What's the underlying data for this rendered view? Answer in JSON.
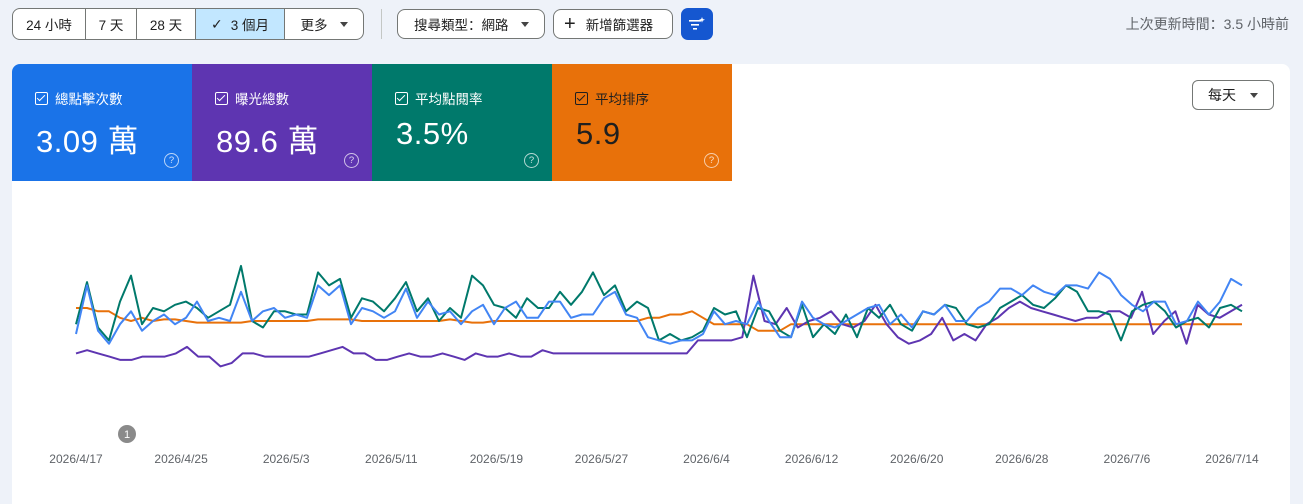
{
  "toolbar": {
    "ranges": [
      {
        "label": "24 小時",
        "active": false
      },
      {
        "label": "7 天",
        "active": false
      },
      {
        "label": "28 天",
        "active": false
      },
      {
        "label": "3 個月",
        "active": true
      },
      {
        "label": "更多",
        "active": false
      }
    ],
    "search_type": "搜尋類型：網路",
    "add_filter": "新增篩選器",
    "last_updated": "上次更新時間：3.5 小時前"
  },
  "metrics": [
    {
      "label": "總點擊次數",
      "value": "3.09 萬",
      "color": "#1a73e8"
    },
    {
      "label": "曝光總數",
      "value": "89.6 萬",
      "color": "#5e35b1"
    },
    {
      "label": "平均點閱率",
      "value": "3.5%",
      "color": "#00796b"
    },
    {
      "label": "平均排序",
      "value": "5.9",
      "color": "#e8710a"
    }
  ],
  "granularity": "每天",
  "annotation": "1",
  "chart_data": {
    "type": "line",
    "x_labels": [
      "2026/4/17",
      "2026/4/25",
      "2026/5/3",
      "2026/5/11",
      "2026/5/19",
      "2026/5/27",
      "2026/6/4",
      "2026/6/12",
      "2026/6/20",
      "2026/6/28",
      "2026/7/6",
      "2026/7/14"
    ],
    "annotation_date": "2026/4/20",
    "series": [
      {
        "name": "總點擊次數",
        "color": "#4285f4",
        "values": [
          42,
          72,
          44,
          36,
          48,
          56,
          44,
          50,
          54,
          48,
          52,
          62,
          50,
          52,
          50,
          68,
          50,
          56,
          58,
          52,
          54,
          52,
          72,
          66,
          72,
          48,
          58,
          56,
          52,
          56,
          70,
          52,
          62,
          54,
          56,
          48,
          56,
          60,
          48,
          58,
          62,
          52,
          52,
          62,
          62,
          52,
          54,
          54,
          64,
          68,
          54,
          52,
          40,
          38,
          36,
          38,
          38,
          42,
          56,
          48,
          50,
          48,
          62,
          50,
          40,
          40,
          62,
          52,
          48,
          46,
          50,
          54,
          58,
          60,
          48,
          54,
          46,
          56,
          54,
          60,
          50,
          50,
          58,
          62,
          70,
          70,
          66,
          72,
          68,
          66,
          72,
          72,
          70,
          80,
          76,
          66,
          60,
          56,
          62,
          62,
          48,
          50,
          62,
          54,
          62,
          76,
          72
        ]
      },
      {
        "name": "曝光總數",
        "color": "#5e35b1",
        "values": [
          30,
          32,
          30,
          28,
          26,
          26,
          28,
          28,
          28,
          30,
          34,
          28,
          28,
          22,
          24,
          30,
          30,
          28,
          28,
          28,
          28,
          28,
          30,
          32,
          34,
          30,
          30,
          26,
          26,
          28,
          30,
          28,
          28,
          30,
          28,
          26,
          30,
          28,
          28,
          30,
          28,
          28,
          32,
          30,
          30,
          30,
          30,
          30,
          30,
          30,
          30,
          30,
          30,
          30,
          30,
          30,
          38,
          38,
          38,
          38,
          40,
          78,
          50,
          48,
          58,
          46,
          50,
          52,
          56,
          48,
          46,
          50,
          60,
          48,
          40,
          36,
          38,
          42,
          52,
          38,
          42,
          38,
          48,
          52,
          58,
          62,
          58,
          56,
          54,
          52,
          50,
          52,
          52,
          56,
          56,
          52,
          68,
          42,
          50,
          56,
          36,
          60,
          54,
          52,
          56,
          60
        ]
      },
      {
        "name": "平均點閱率",
        "color": "#00796b",
        "values": [
          48,
          74,
          46,
          38,
          62,
          78,
          48,
          58,
          56,
          60,
          62,
          58,
          52,
          56,
          60,
          84,
          50,
          46,
          56,
          56,
          54,
          54,
          80,
          72,
          76,
          52,
          64,
          62,
          56,
          64,
          74,
          56,
          64,
          50,
          58,
          52,
          78,
          72,
          60,
          58,
          52,
          64,
          58,
          58,
          68,
          60,
          68,
          80,
          66,
          72,
          56,
          62,
          58,
          38,
          42,
          38,
          40,
          44,
          58,
          54,
          56,
          40,
          58,
          56,
          44,
          40,
          60,
          40,
          48,
          42,
          54,
          40,
          58,
          52,
          60,
          48,
          44,
          56,
          54,
          60,
          58,
          48,
          46,
          48,
          58,
          62,
          66,
          60,
          58,
          64,
          72,
          68,
          56,
          56,
          54,
          38,
          56,
          60,
          62,
          56,
          46,
          50,
          52,
          46,
          58,
          60,
          56
        ]
      },
      {
        "name": "平均排序",
        "color": "#e8710a",
        "values": [
          58,
          58,
          56,
          56,
          52,
          50,
          52,
          50,
          51,
          51,
          50,
          49,
          49,
          49,
          49,
          49,
          50,
          50,
          50,
          50,
          50,
          50,
          51,
          51,
          51,
          51,
          50,
          50,
          50,
          50,
          50,
          50,
          50,
          50,
          51,
          50,
          49,
          49,
          50,
          50,
          50,
          50,
          50,
          50,
          50,
          50,
          50,
          50,
          50,
          50,
          50,
          50,
          52,
          52,
          54,
          54,
          56,
          52,
          48,
          48,
          48,
          48,
          44,
          44,
          44,
          48,
          48,
          48,
          48,
          48,
          48,
          48,
          48,
          48,
          48,
          48,
          48,
          48,
          48,
          48,
          48,
          48,
          48,
          48,
          48,
          48,
          48,
          48,
          48,
          48,
          48,
          48,
          48,
          48,
          48,
          48,
          48,
          48,
          48,
          48,
          48,
          48,
          48,
          48,
          48,
          48,
          48
        ]
      }
    ]
  }
}
